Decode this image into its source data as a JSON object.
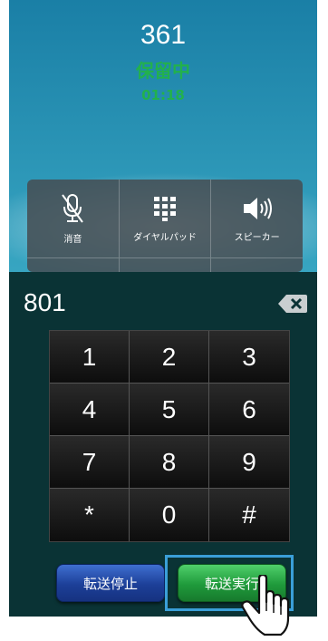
{
  "call": {
    "number": "361",
    "status": "保留中",
    "timer": "01:18"
  },
  "controls": [
    {
      "label": "消音",
      "icon": "mute-mic-icon"
    },
    {
      "label": "ダイヤルパッド",
      "icon": "dialpad-icon"
    },
    {
      "label": "スピーカー",
      "icon": "speaker-icon"
    }
  ],
  "dialer": {
    "number": "801",
    "keys": [
      "1",
      "2",
      "3",
      "4",
      "5",
      "6",
      "7",
      "8",
      "9",
      "*",
      "0",
      "#"
    ]
  },
  "actions": {
    "stop_label": "転送停止",
    "exec_label": "転送実行"
  },
  "colors": {
    "status_green": "#22b14c",
    "dialer_bg": "#0a3335",
    "stop_blue": "#1c3f98",
    "exec_green": "#1f9a3b",
    "highlight": "#3a9fd8"
  }
}
